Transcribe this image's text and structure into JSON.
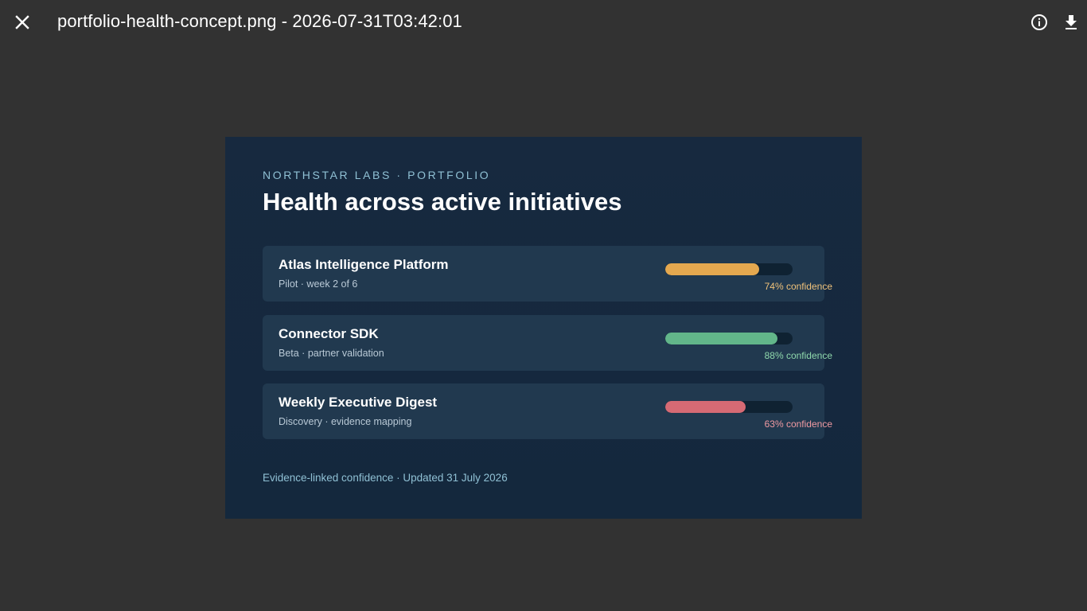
{
  "viewer": {
    "file_title": "portfolio-health-concept.png - 2026-07-31T03:42:01",
    "icons": {
      "close": "close-icon",
      "info": "info-icon",
      "download": "download-icon"
    }
  },
  "image": {
    "eyebrow": "NORTHSTAR LABS · PORTFOLIO",
    "headline": "Health across active initiatives",
    "footer": "Evidence-linked confidence · Updated 31 July 2026",
    "initiatives": [
      {
        "title": "Atlas Intelligence Platform",
        "subtitle": "Pilot · week 2 of 6",
        "confidence": 74,
        "confidence_label": "74% confidence",
        "bar_color": "#e4a84f",
        "label_color": "#f0c27a"
      },
      {
        "title": "Connector SDK",
        "subtitle": "Beta · partner validation",
        "confidence": 88,
        "confidence_label": "88% confidence",
        "bar_color": "#62b68a",
        "label_color": "#8fd8ac"
      },
      {
        "title": "Weekly Executive Digest",
        "subtitle": "Discovery · evidence mapping",
        "confidence": 63,
        "confidence_label": "63% confidence",
        "bar_color": "#d66a74",
        "label_color": "#f09aa2"
      }
    ]
  },
  "colors": {
    "viewer_background": "#323232",
    "image_background": "#17293f",
    "card_background": "#21394f"
  }
}
